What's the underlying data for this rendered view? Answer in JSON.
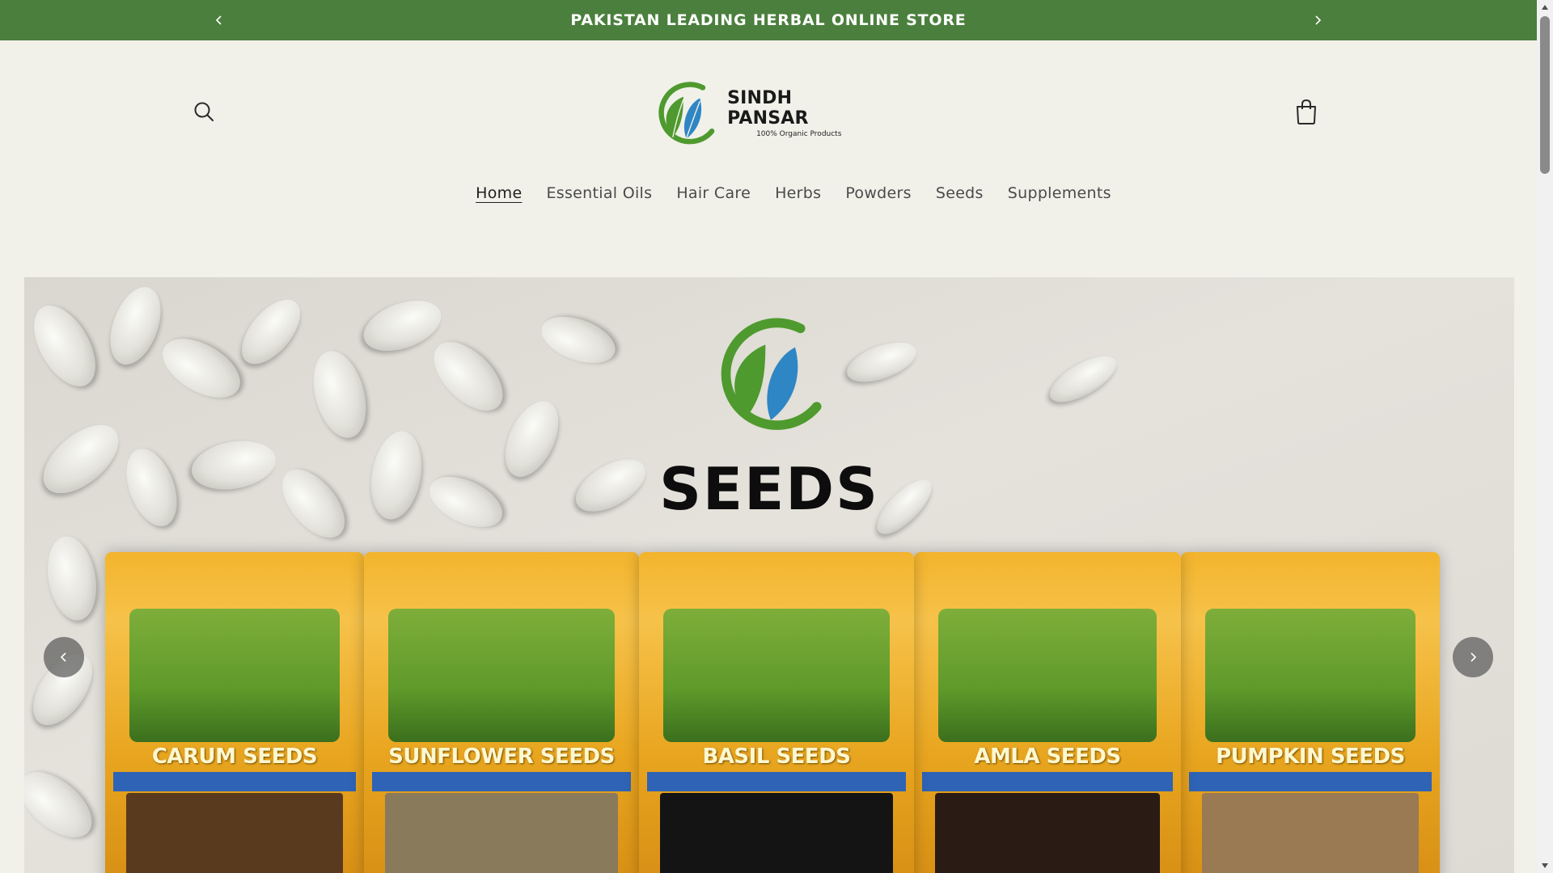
{
  "announcement": {
    "text": "PAKISTAN LEADING HERBAL ONLINE STORE",
    "prev_icon": "chevron-left-icon",
    "next_icon": "chevron-right-icon"
  },
  "header": {
    "logo_name": "SINDH PANSAR",
    "logo_tagline": "100% Organic Products",
    "search_icon": "search-icon",
    "cart_icon": "cart-icon"
  },
  "nav": {
    "items": [
      {
        "label": "Home",
        "active": true
      },
      {
        "label": "Essential Oils",
        "active": false
      },
      {
        "label": "Hair Care",
        "active": false
      },
      {
        "label": "Herbs",
        "active": false
      },
      {
        "label": "Powders",
        "active": false
      },
      {
        "label": "Seeds",
        "active": false
      },
      {
        "label": "Supplements",
        "active": false
      }
    ]
  },
  "hero": {
    "title": "SEEDS",
    "packs": [
      {
        "label": "CARUM SEEDS",
        "contents_color": "#5a3a1e"
      },
      {
        "label": "SUNFLOWER SEEDS",
        "contents_color": "#8a7a5c"
      },
      {
        "label": "BASIL SEEDS",
        "contents_color": "#141414"
      },
      {
        "label": "AMLA SEEDS",
        "contents_color": "#2a1c14"
      },
      {
        "label": "PUMPKIN SEEDS",
        "contents_color": "#9a7a52"
      }
    ],
    "prev_icon": "chevron-left-icon",
    "next_icon": "chevron-right-icon"
  },
  "colors": {
    "announcement_bg": "#4b7f3d",
    "page_bg": "#f1f1ea",
    "logo_green": "#4f9a2e",
    "logo_blue": "#2f86c4"
  }
}
